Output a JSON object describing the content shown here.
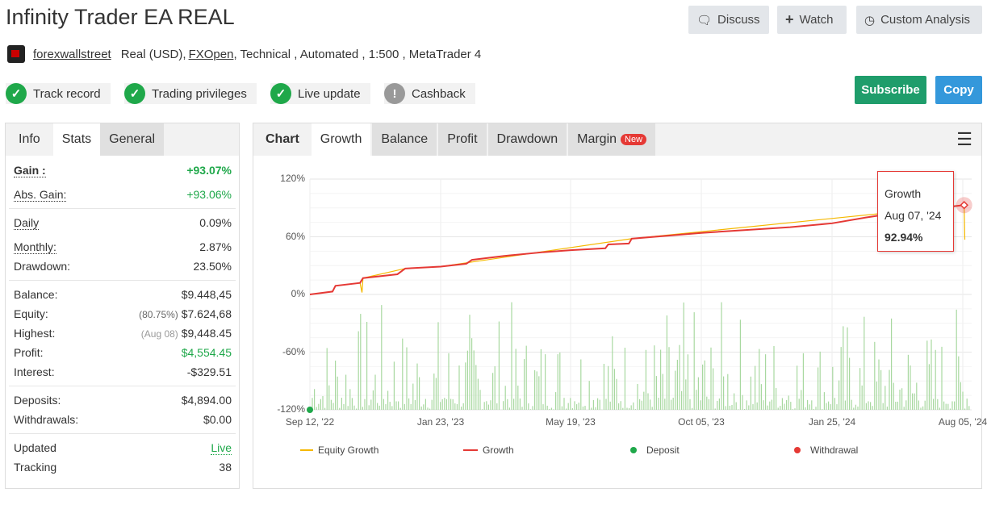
{
  "header": {
    "title": "Infinity Trader EA REAL",
    "discuss": "Discuss",
    "watch": "Watch",
    "custom_analysis": "Custom Analysis"
  },
  "subtitle": {
    "user": "forexwallstreet",
    "account": "Real (USD),",
    "broker": "FXOpen",
    "details": ", Technical , Automated , 1:500 , MetaTrader 4"
  },
  "badges": [
    {
      "label": "Track record",
      "icon": "check-icon"
    },
    {
      "label": "Trading privileges",
      "icon": "check-icon"
    },
    {
      "label": "Live update",
      "icon": "check-icon"
    },
    {
      "label": "Cashback",
      "icon": "exclamation-icon"
    }
  ],
  "actions": {
    "subscribe": "Subscribe",
    "copy": "Copy",
    "subscribe_color": "#1f9d6b",
    "copy_color": "#3498db"
  },
  "stats": {
    "tabs": [
      "Info",
      "Stats",
      "General"
    ],
    "gain": {
      "label": "Gain :",
      "value": "+93.07%"
    },
    "abs_gain": {
      "label": "Abs. Gain:",
      "value": "+93.06%"
    },
    "daily": {
      "label": "Daily",
      "value": "0.09%"
    },
    "monthly": {
      "label": "Monthly:",
      "value": "2.87%"
    },
    "drawdown": {
      "label": "Drawdown:",
      "value": "23.50%"
    },
    "balance": {
      "label": "Balance:",
      "value": "$9.448,45"
    },
    "equity": {
      "label": "Equity:",
      "note": "(80.75%)",
      "value": "$7.624,68"
    },
    "highest": {
      "label": "Highest:",
      "note": "(Aug 08)",
      "value": "$9,448.45"
    },
    "profit": {
      "label": "Profit:",
      "value": "$4,554.45"
    },
    "interest": {
      "label": "Interest:",
      "value": "-$329.51"
    },
    "deposits": {
      "label": "Deposits:",
      "value": "$4,894.00"
    },
    "withdrawals": {
      "label": "Withdrawals:",
      "value": "$0.00"
    },
    "updated": {
      "label": "Updated",
      "value": "Live"
    },
    "tracking": {
      "label": "Tracking",
      "value": "38"
    }
  },
  "chart_tabs": {
    "title": "Chart",
    "tabs": [
      "Growth",
      "Balance",
      "Profit",
      "Drawdown",
      "Margin"
    ],
    "new_badge": "New"
  },
  "tooltip": {
    "series": "Growth",
    "date": "Aug 07, '24",
    "value": "92.94%"
  },
  "chart_data": {
    "type": "line",
    "ylim": [
      -120,
      120
    ],
    "yticks": [
      "120%",
      "60%",
      "0%",
      "-60%",
      "-120%"
    ],
    "xticks": [
      "Sep 12, '22",
      "Jan 23, '23",
      "May 19, '23",
      "Oct 05, '23",
      "Jan 25, '24",
      "Aug 05, '24"
    ],
    "legend": [
      "Equity Growth",
      "Growth",
      "Deposit",
      "Withdrawal"
    ],
    "colors": {
      "equity": "#f5b800",
      "growth": "#e53935",
      "deposit": "#1fa84a",
      "withdrawal": "#e53935",
      "bars": "#a8d8a0"
    },
    "growth": [
      [
        "2022-09-12",
        0
      ],
      [
        "2022-10-05",
        3
      ],
      [
        "2022-10-08",
        9
      ],
      [
        "2022-11-02",
        12
      ],
      [
        "2022-11-05",
        17
      ],
      [
        "2022-12-10",
        21
      ],
      [
        "2022-12-18",
        27
      ],
      [
        "2023-01-23",
        29
      ],
      [
        "2023-02-15",
        32
      ],
      [
        "2023-02-20",
        36
      ],
      [
        "2023-03-20",
        40
      ],
      [
        "2023-04-25",
        44
      ],
      [
        "2023-05-19",
        46
      ],
      [
        "2023-06-25",
        48
      ],
      [
        "2023-06-28",
        52
      ],
      [
        "2023-07-20",
        53
      ],
      [
        "2023-07-23",
        58
      ],
      [
        "2023-10-05",
        64
      ],
      [
        "2023-12-20",
        70
      ],
      [
        "2024-01-25",
        74
      ],
      [
        "2024-03-15",
        80
      ],
      [
        "2024-05-10",
        86
      ],
      [
        "2024-08-07",
        92.94
      ]
    ],
    "equity": [
      [
        "2022-09-12",
        0
      ],
      [
        "2022-10-05",
        3
      ],
      [
        "2022-10-08",
        9
      ],
      [
        "2022-11-02",
        12
      ],
      [
        "2022-11-04",
        2
      ],
      [
        "2022-11-05",
        17
      ],
      [
        "2022-12-18",
        27
      ],
      [
        "2023-01-23",
        29
      ],
      [
        "2023-07-23",
        58
      ],
      [
        "2024-08-07",
        92.94
      ],
      [
        "2024-08-08",
        57
      ]
    ],
    "deposits": [
      [
        "2022-09-12",
        -120
      ]
    ]
  }
}
